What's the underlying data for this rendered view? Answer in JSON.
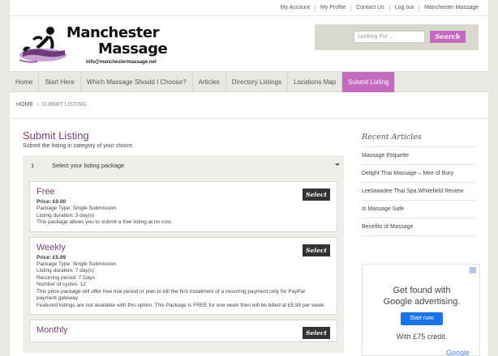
{
  "topbar": {
    "links": [
      "My Account",
      "My Profile",
      "Contact Us",
      "Log out",
      "Manchester Massage"
    ]
  },
  "logo": {
    "title": "Manchester",
    "sub": "Massage",
    "email": "info@manchestermassage.net"
  },
  "search": {
    "placeholder": "Looking For ...",
    "button": "Search"
  },
  "nav": {
    "items": [
      "Home",
      "Start Here",
      "Which Massage Should I Choose?",
      "Articles",
      "Directory Listings",
      "Locations Map",
      "Submit Listing"
    ],
    "active_index": 6
  },
  "breadcrumb": {
    "home": "HOME",
    "sep": "›",
    "current": "SUBMIT LISTING"
  },
  "main": {
    "title": "Submit Listing",
    "subtitle": "Submit the listing in category of your choice.",
    "step": {
      "num": "1",
      "label": "Select your listing package"
    }
  },
  "packages": [
    {
      "name": "Free",
      "price": "Price: £0.00",
      "lines": [
        "Package Type: Single Submission",
        "Listing duration: 3 day(s)",
        "This package allows you to submit a free listing at no cost."
      ],
      "select": "Select"
    },
    {
      "name": "Weekly",
      "price": "Price: £5.99",
      "lines": [
        "Package Type: Single Submission",
        "Listing duration: 7 day(s)",
        "Recurring period: 7 Days",
        "Number of cycles: 12",
        "This price package will offer free trial period or plan to bill the first instalment of a recurring payment only for PayPal",
        "payment gateway.",
        "Featured listings are not available with this option. This Package is FREE for one week then will be billed at £5.99 per week."
      ],
      "select": "Select"
    },
    {
      "name": "Monthly",
      "price": "",
      "lines": [],
      "select": "Select"
    }
  ],
  "sidebar": {
    "title": "Recent Articles",
    "items": [
      "Massage Etiquette",
      "Delight Thai Massage – Mee of Bury",
      "Leelawadee Thai Spa Whitefield Review",
      "Is Massage Safe",
      "Benefits of Massage"
    ]
  },
  "ad": {
    "line1": "Get found with",
    "line2": "Google advertising.",
    "button": "Start now",
    "line3": "With £75 credit.",
    "logo": "Google"
  },
  "colors": {
    "accent": "#c46bbf",
    "heading": "#7a3f7a",
    "nav_bg": "#e9e9e3"
  }
}
